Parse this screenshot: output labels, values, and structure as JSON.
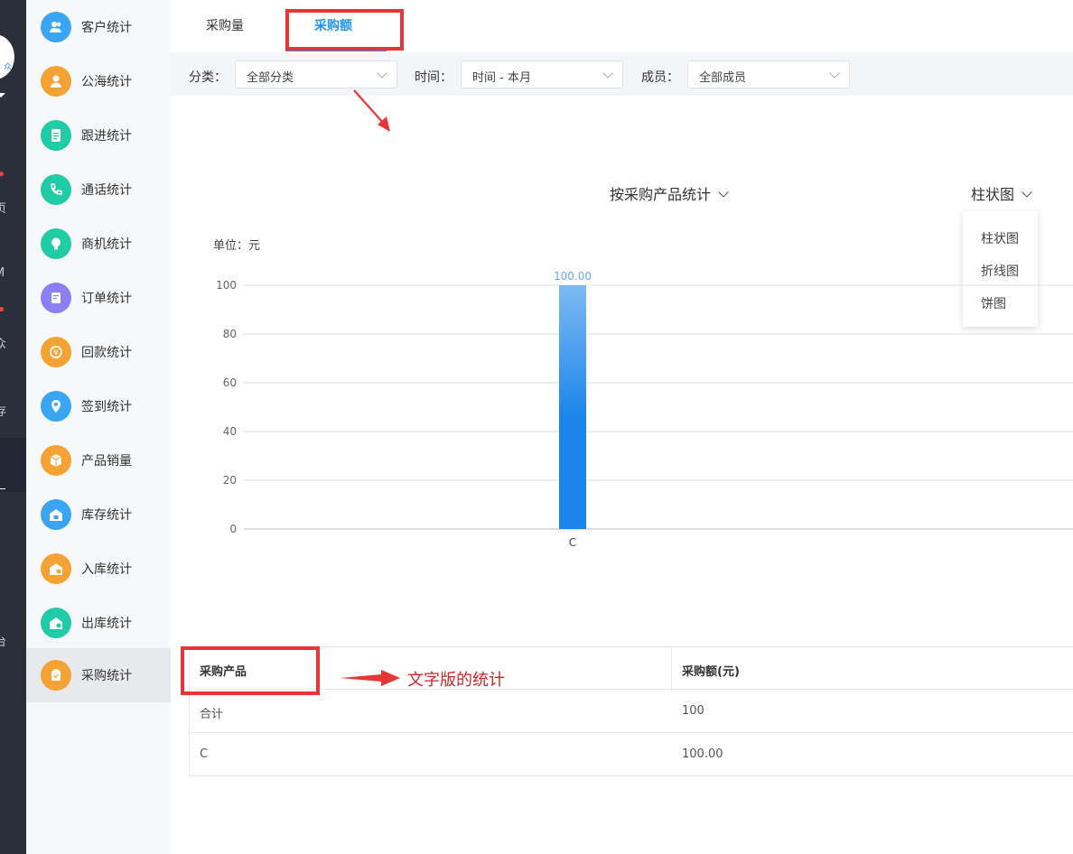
{
  "rail": {
    "avatar_text": "众",
    "items": [
      "页",
      "M",
      "众",
      "存",
      "台"
    ]
  },
  "sidebar": {
    "items": [
      {
        "label": "客户统计",
        "color": "#3aa6f2",
        "icon": "users-icon"
      },
      {
        "label": "公海统计",
        "color": "#f5a235",
        "icon": "person-icon"
      },
      {
        "label": "跟进统计",
        "color": "#1fcca6",
        "icon": "document-icon"
      },
      {
        "label": "通话统计",
        "color": "#1fcca6",
        "icon": "phone-icon"
      },
      {
        "label": "商机统计",
        "color": "#1fcca6",
        "icon": "lightbulb-icon"
      },
      {
        "label": "订单统计",
        "color": "#8a7ff5",
        "icon": "order-icon"
      },
      {
        "label": "回款统计",
        "color": "#f5a235",
        "icon": "payment-icon"
      },
      {
        "label": "签到统计",
        "color": "#3aa6f2",
        "icon": "location-icon"
      },
      {
        "label": "产品销量",
        "color": "#f5a235",
        "icon": "box-icon"
      },
      {
        "label": "库存统计",
        "color": "#3aa6f2",
        "icon": "warehouse-icon"
      },
      {
        "label": "入库统计",
        "color": "#f5a235",
        "icon": "stock-in-icon"
      },
      {
        "label": "出库统计",
        "color": "#1fcca6",
        "icon": "stock-out-icon"
      },
      {
        "label": "采购统计",
        "color": "#f5a235",
        "icon": "purchase-icon"
      }
    ]
  },
  "tabs": [
    {
      "label": "采购量"
    },
    {
      "label": "采购额"
    }
  ],
  "filters": {
    "category_label": "分类：",
    "category_value": "全部分类",
    "time_label": "时间：",
    "time_value": "时间 - 本月",
    "member_label": "成员：",
    "member_value": "全部成员"
  },
  "stat_by": "按采购产品统计",
  "chart_type": {
    "selected": "柱状图",
    "options": [
      "柱状图",
      "折线图",
      "饼图"
    ]
  },
  "unit_label": "单位：元",
  "chart_data": {
    "type": "bar",
    "categories": [
      "C"
    ],
    "values": [
      100
    ],
    "data_labels": [
      "100.00"
    ],
    "yticks": [
      0,
      20,
      40,
      60,
      80,
      100
    ],
    "ylim": [
      0,
      100
    ],
    "bar_color_top": "#7dbaf4",
    "bar_color_bottom": "#1a85ea",
    "grid": true
  },
  "table": {
    "headers": [
      "采购产品",
      "采购额(元)"
    ],
    "rows": [
      [
        "合计",
        "100"
      ],
      [
        "C",
        "100.00"
      ]
    ]
  },
  "annotation_text": "文字版的统计"
}
